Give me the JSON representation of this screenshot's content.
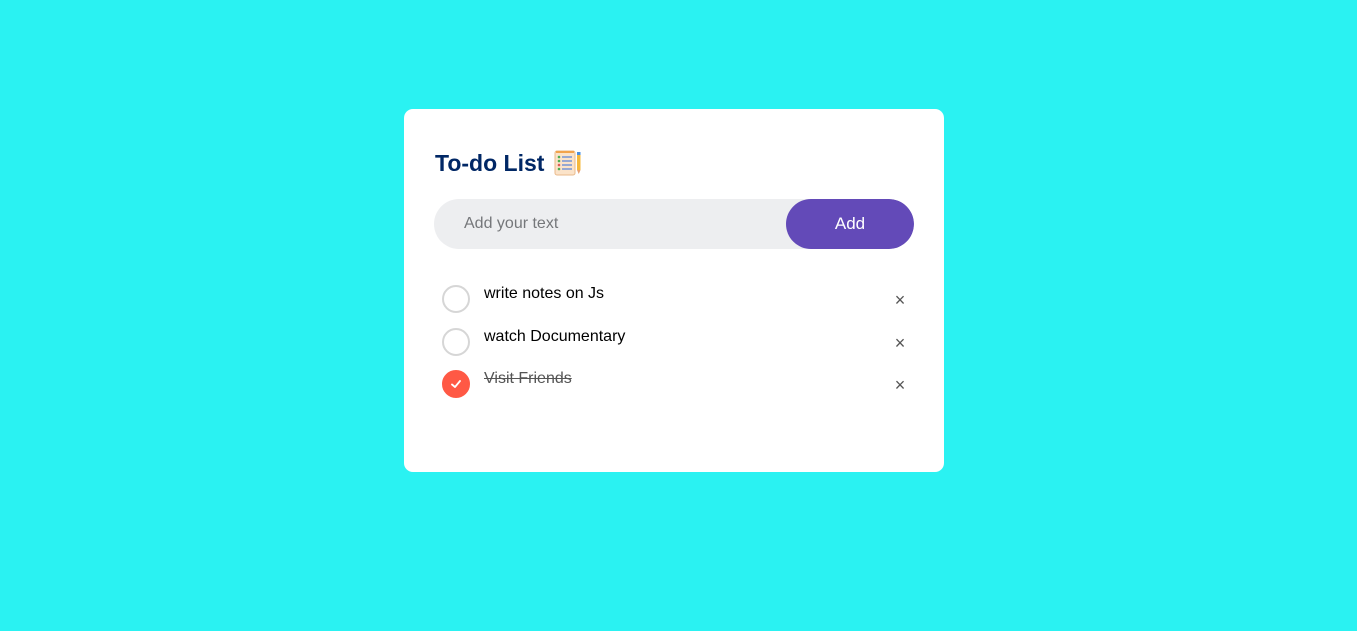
{
  "header": {
    "title": "To-do List",
    "icon": "notepad-icon"
  },
  "input": {
    "placeholder": "Add your text",
    "value": ""
  },
  "add_button": {
    "label": "Add"
  },
  "tasks": [
    {
      "text": "write notes on Js",
      "done": false,
      "delete_label": "×"
    },
    {
      "text": "watch Documentary",
      "done": false,
      "delete_label": "×"
    },
    {
      "text": "Visit Friends",
      "done": true,
      "delete_label": "×"
    }
  ],
  "colors": {
    "background": "#2af2f2",
    "card": "#ffffff",
    "title": "#002765",
    "accent": "#634ab8",
    "checked": "#ff5945"
  }
}
